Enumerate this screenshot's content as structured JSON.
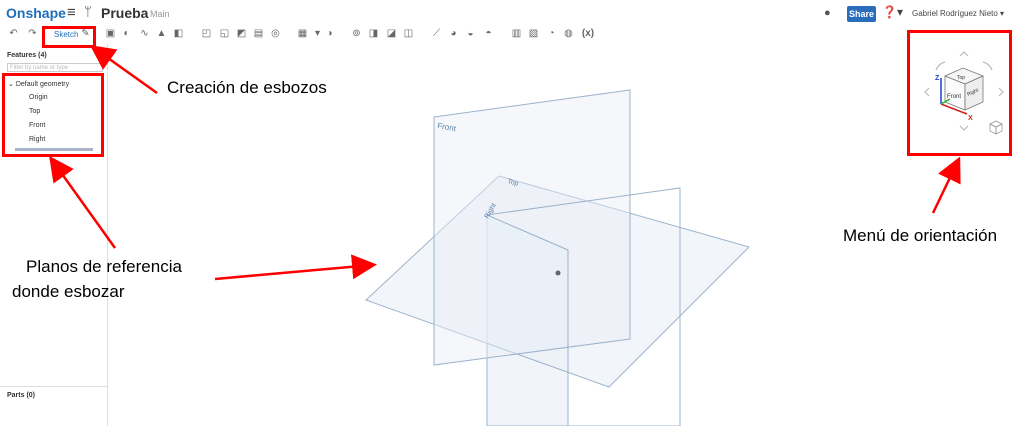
{
  "app": {
    "logo": "Onshape",
    "document_title": "Prueba",
    "branch": "Main",
    "share_label": "Share",
    "user_name": "Gabriel Rodríguez Nieto ▾"
  },
  "toolbar": {
    "sketch_label": "Sketch",
    "variable_label": "(x)"
  },
  "feature_panel": {
    "features_header": "Features (4)",
    "filter_placeholder": "Filter by name or type",
    "default_geometry_label": "Default geometry",
    "items": [
      "Origin",
      "Top",
      "Front",
      "Right"
    ],
    "parts_header": "Parts (0)"
  },
  "viewport": {
    "plane_labels": {
      "front": "Front",
      "top": "Top",
      "right": "Right"
    }
  },
  "view_cube": {
    "faces": {
      "top": "Top",
      "front": "Front",
      "right": "Right"
    },
    "axes": {
      "z": "Z",
      "x": "X"
    }
  },
  "annotations": {
    "sketch_creation": "Creación de esbozos",
    "reference_planes_line1": "Planos de referencia",
    "reference_planes_line2": "donde esbozar",
    "orientation_menu": "Menú de orientación"
  },
  "colors": {
    "annotation_red": "#ff0000",
    "plane_stroke": "#9cb3cc",
    "plane_fill": "#e8eef6",
    "brand_blue": "#1e6fb8",
    "share_blue": "#2a6ebb"
  }
}
